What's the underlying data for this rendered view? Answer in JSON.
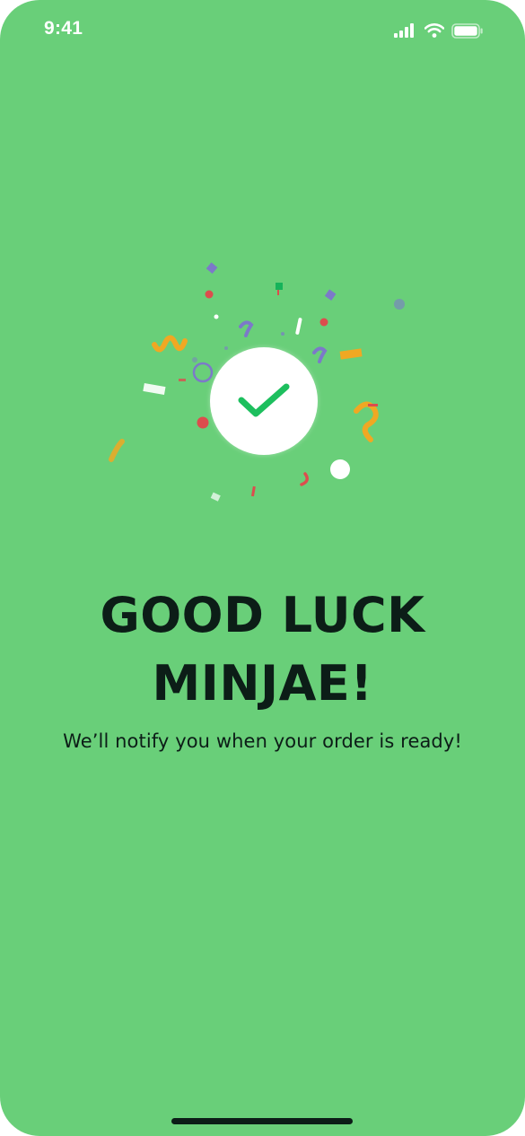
{
  "status_bar": {
    "time": "9:41",
    "icons": [
      "signal-icon",
      "wifi-icon",
      "battery-icon"
    ]
  },
  "confirmation": {
    "icon": "checkmark-icon",
    "headline_line1": "GOOD LUCK",
    "headline_line2": "MINJAE!",
    "message": "We’ll notify you when your order is ready!"
  },
  "colors": {
    "background": "#69cf79",
    "text": "#0c1d17",
    "check": "#1dbf5e",
    "confetti": [
      "#f0a823",
      "#dc4d4d",
      "#7c79c9",
      "#ffffff",
      "#16b35a"
    ]
  }
}
